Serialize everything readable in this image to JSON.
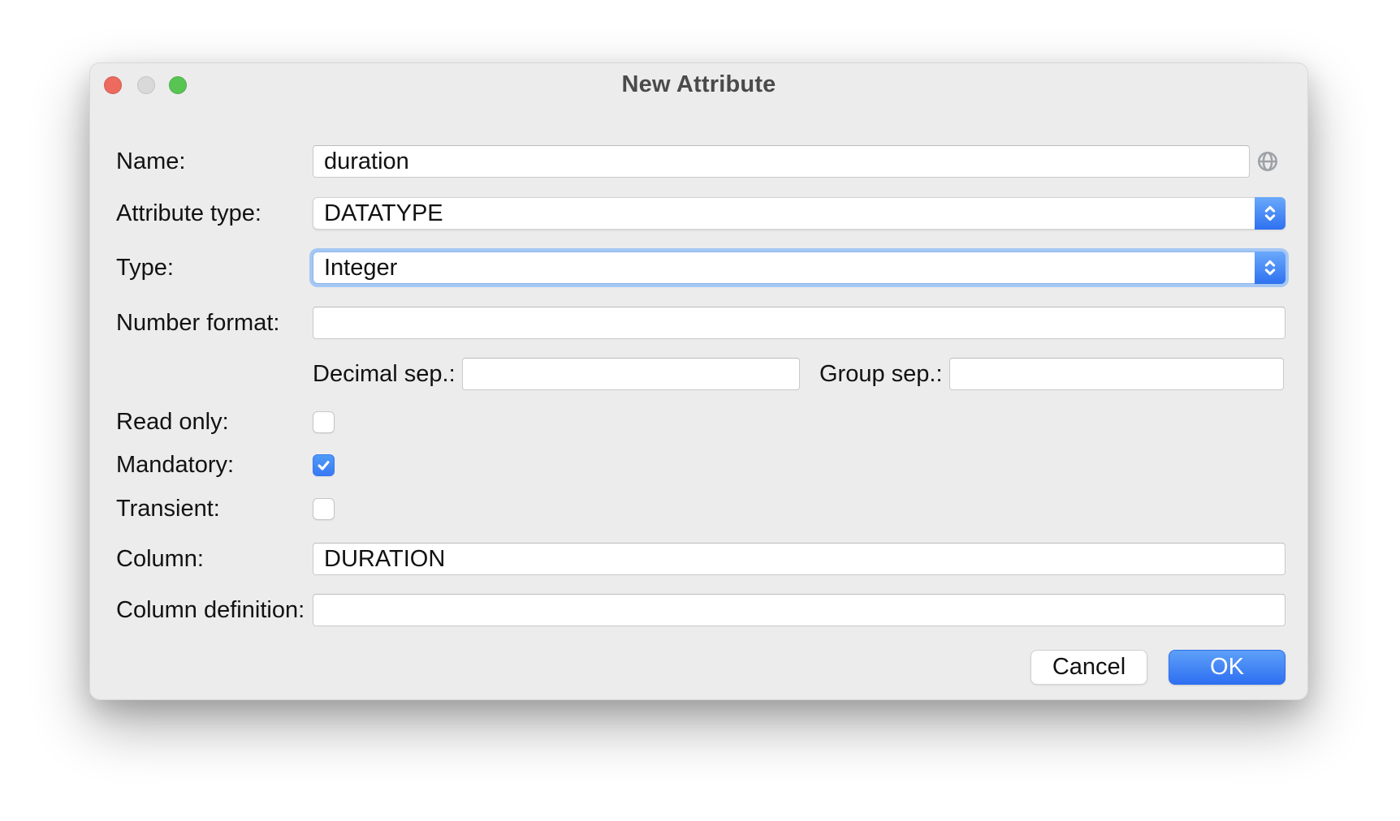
{
  "window": {
    "title": "New Attribute",
    "traffic_lights": {
      "close_color": "#ED6A5F",
      "minimize_color": "#D9D9D9",
      "zoom_color": "#58C553"
    }
  },
  "form": {
    "name": {
      "label": "Name:",
      "value": "duration"
    },
    "attribute_type": {
      "label": "Attribute type:",
      "value": "DATATYPE"
    },
    "type": {
      "label": "Type:",
      "value": "Integer",
      "focused": true
    },
    "number_format": {
      "label": "Number format:",
      "value": ""
    },
    "decimal_sep": {
      "label": "Decimal sep.:",
      "value": ""
    },
    "group_sep": {
      "label": "Group sep.:",
      "value": ""
    },
    "read_only": {
      "label": "Read only:",
      "checked": false
    },
    "mandatory": {
      "label": "Mandatory:",
      "checked": true
    },
    "transient": {
      "label": "Transient:",
      "checked": false
    },
    "column": {
      "label": "Column:",
      "value": "DURATION"
    },
    "column_definition": {
      "label": "Column definition:",
      "value": ""
    }
  },
  "actions": {
    "cancel": "Cancel",
    "ok": "OK"
  },
  "icons": {
    "globe": "globe-icon",
    "dropdown_stepper": "chevron-up-down-icon",
    "checkbox_check": "check-icon"
  },
  "colors": {
    "dialog_bg": "#ECECEC",
    "accent_blue": "#3376F6",
    "focus_ring": "#A5C7F4",
    "checkbox_checked": "#4A90F7"
  }
}
